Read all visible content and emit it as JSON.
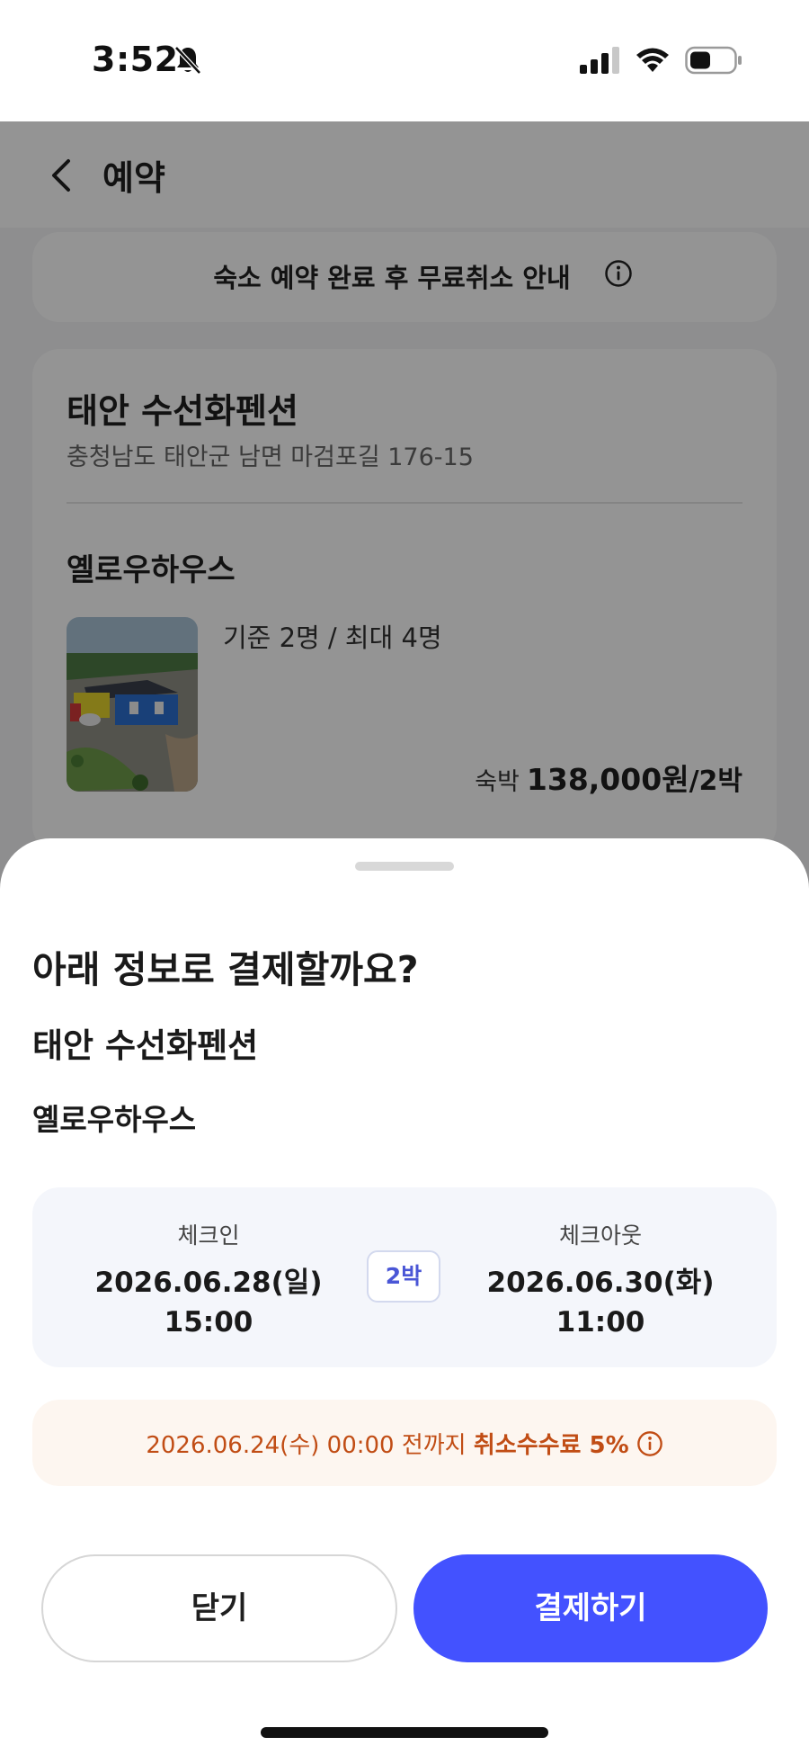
{
  "status_bar": {
    "time": "3:52",
    "icons": [
      "bell-slash-icon",
      "signal-icon",
      "wifi-icon",
      "battery-icon"
    ]
  },
  "header": {
    "back_icon": "chevron-left-icon",
    "title": "예약"
  },
  "notice": {
    "text": "숙소 예약 완료 후 무료취소 안내",
    "icon": "info-icon"
  },
  "stay": {
    "name": "태안 수선화펜션",
    "address": "충청남도 태안군 남면 마검포길 176-15",
    "room": {
      "name": "옐로우하우스",
      "capacity": "기준 2명 / 최대 4명",
      "price_label": "숙박",
      "price": "138,000원",
      "nights_suffix": "/2박"
    }
  },
  "sheet": {
    "title": "아래 정보로 결제할까요?",
    "stay_name": "태안 수선화펜션",
    "room_name": "옐로우하우스",
    "checkin": {
      "label": "체크인",
      "date": "2026.06.28(일)",
      "time": "15:00"
    },
    "nights": "2박",
    "checkout": {
      "label": "체크아웃",
      "date": "2026.06.30(화)",
      "time": "11:00"
    },
    "fee_notice": {
      "prefix": "2026.06.24(수) 00:00 전까지 ",
      "emphasis": "취소수수료 5%",
      "icon": "info-icon"
    },
    "buttons": {
      "close": "닫기",
      "pay": "결제하기"
    }
  },
  "colors": {
    "accent": "#4352ff",
    "nights_badge_text": "#4a56d6",
    "fee_text": "#c14d15",
    "fee_background": "#fdf6f0",
    "date_background": "#f4f6fb"
  }
}
